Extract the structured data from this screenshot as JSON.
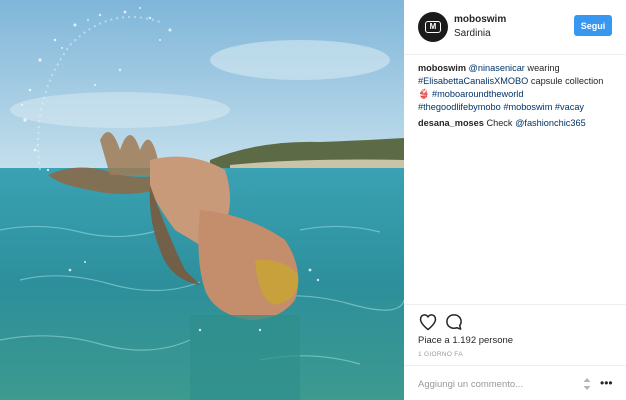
{
  "post": {
    "username": "moboswim",
    "location": "Sardinia",
    "follow_label": "Segui"
  },
  "caption": {
    "username": "moboswim",
    "line1_mention": "@ninasenicar",
    "line1_text": " wearing",
    "line2_tag": "#ElisabettaCanalisXMOBO",
    "line2_text": " capsule collection",
    "line3_emoji": "👙",
    "line3_tag": "#moboaroundtheworld",
    "line4_tag1": "#thegoodlifebymobo",
    "line4_tag2": "#moboswim",
    "line4_tag3": "#vacay"
  },
  "comments": [
    {
      "username": "desana_moses",
      "text": "Check ",
      "mention": "@fashionchic365"
    }
  ],
  "engagement": {
    "likes_label": "Piace a 1.192 persone",
    "time_label": "1 GIORNO FA"
  },
  "add_comment": {
    "placeholder": "Aggiungi un commento..."
  },
  "icons": {
    "heart": "heart-icon",
    "comment": "comment-bubble-icon",
    "sort": "up-down-icon",
    "more": "more-options-icon",
    "avatar": "mobo-logo-avatar"
  },
  "colors": {
    "follow_button": "#3897f0",
    "hashtag": "#003569",
    "muted": "#999999"
  }
}
